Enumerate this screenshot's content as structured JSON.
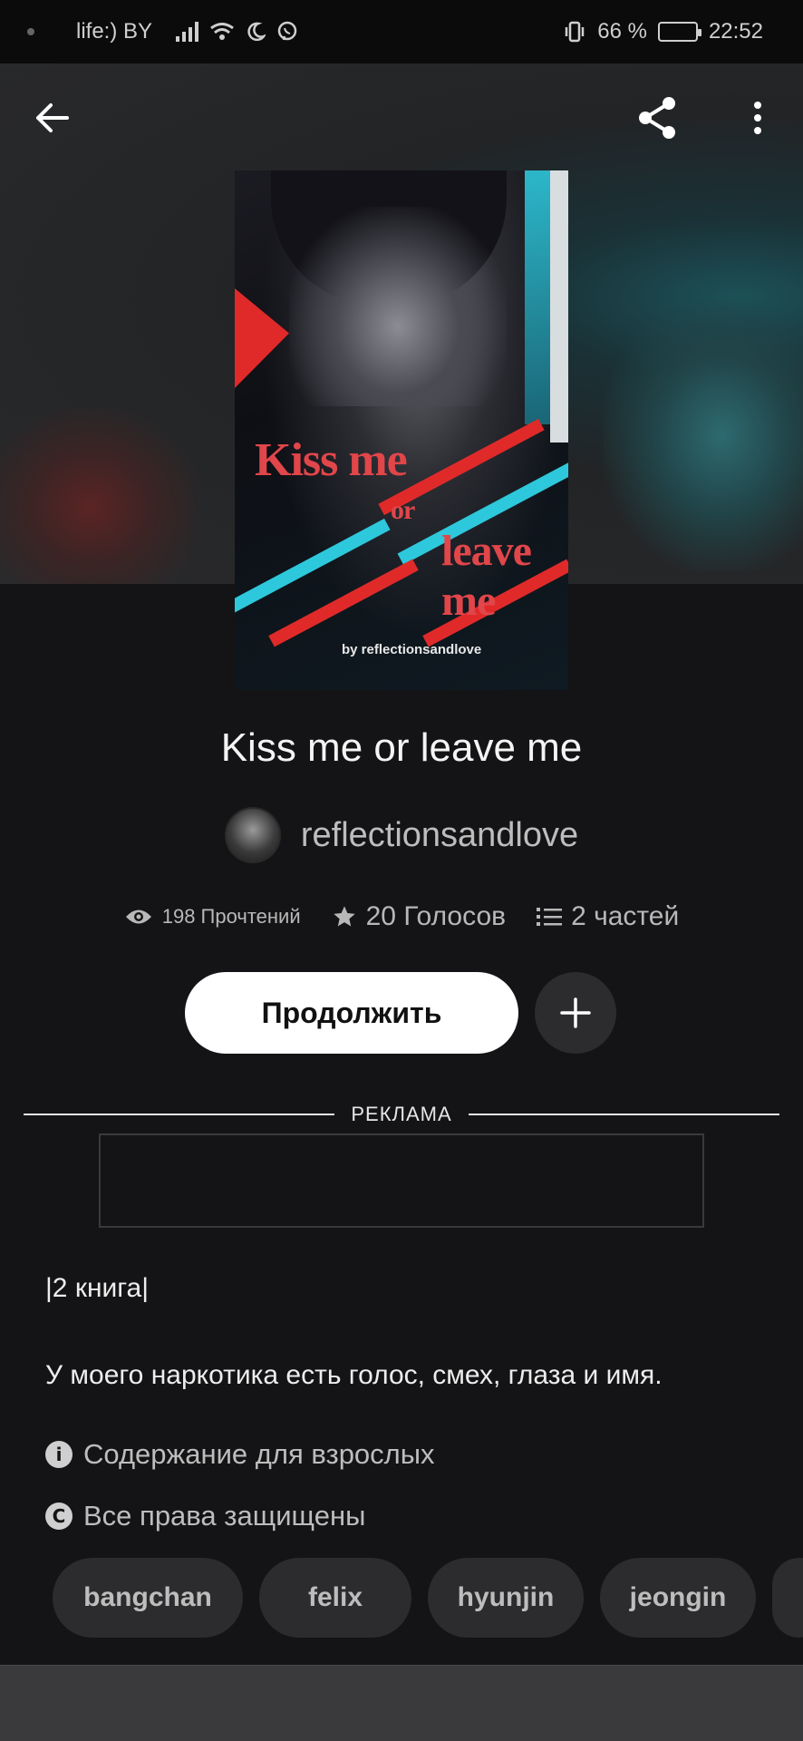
{
  "status_bar": {
    "carrier": "life:) BY",
    "battery_percent": "66 %",
    "battery_level": 0.66,
    "time": "22:52"
  },
  "colors": {
    "background": "#141315",
    "accent_button": "#ffffff",
    "chip": "#2c2c2e"
  },
  "top_bar": {
    "back_icon": "arrow-left-icon",
    "share_icon": "share-icon",
    "menu_icon": "more-vertical-icon"
  },
  "cover": {
    "title_line1": "Kiss me",
    "title_line2": "or",
    "title_line3": "leave me",
    "byline": "by reflectionsandlove"
  },
  "book": {
    "title": "Kiss me or leave me",
    "author": "reflectionsandlove"
  },
  "stats": {
    "reads": "198 Прочтений",
    "votes": "20 Голосов",
    "parts": "2 частей"
  },
  "actions": {
    "continue_label": "Продолжить",
    "add_icon": "plus-icon"
  },
  "ad": {
    "label": "РЕКЛАМА"
  },
  "description": {
    "line1": "|2 книга|",
    "line2": "У моего наркотика есть голос, смех, глаза и имя."
  },
  "meta": {
    "mature": "Содержание для взрослых",
    "rights": "Все права защищены"
  },
  "tags": [
    "bangchan",
    "felix",
    "hyunjin",
    "jeongin"
  ]
}
